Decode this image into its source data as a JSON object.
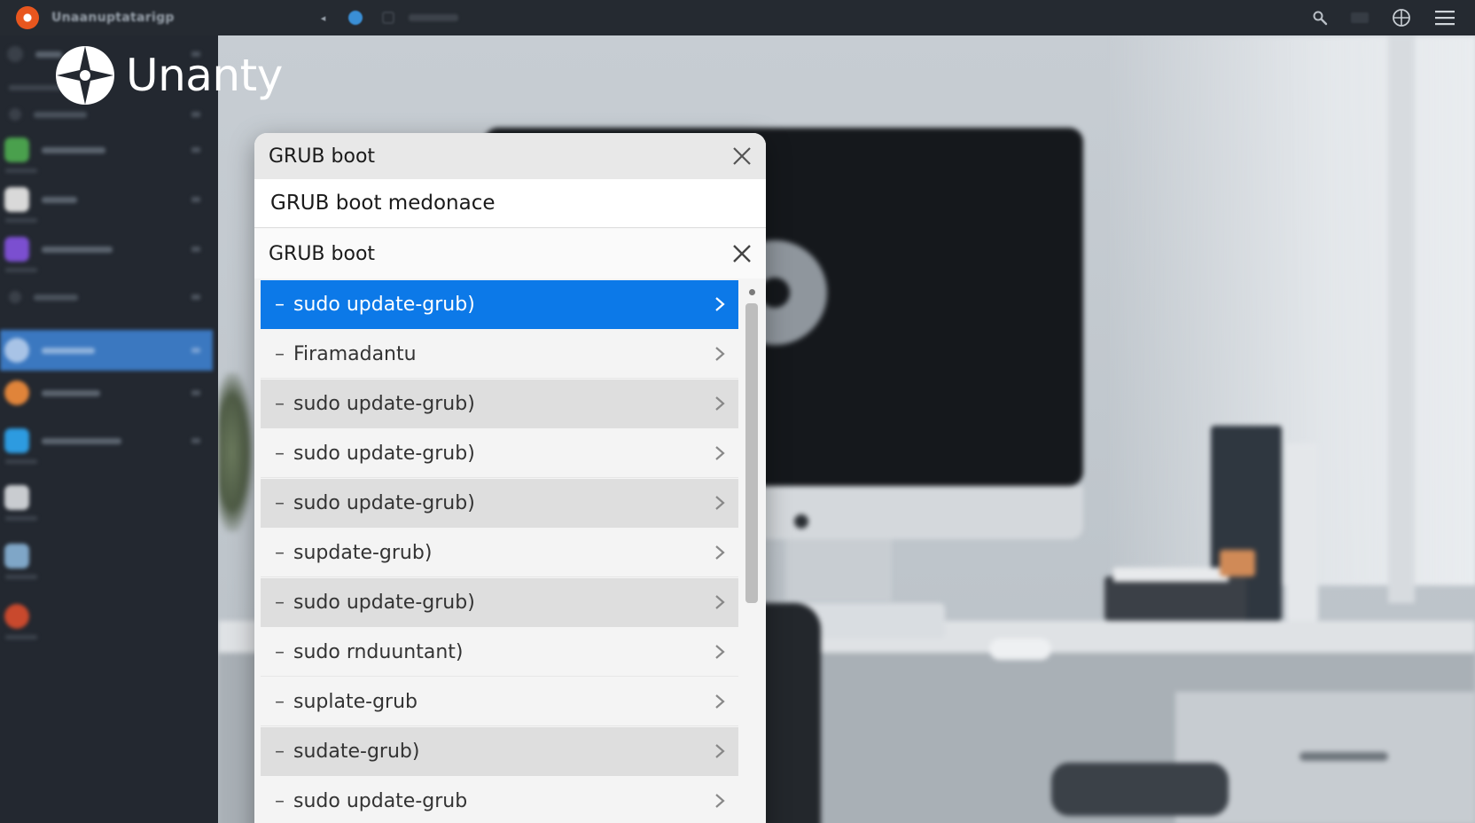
{
  "topbar": {
    "title": "Unaanuptatarigp",
    "arrow": "◂",
    "icons": [
      "app-logo-icon",
      "search-icon",
      "grid-icon",
      "globe-icon",
      "hamburger-menu-icon"
    ]
  },
  "brand": {
    "name": "Unanty"
  },
  "dialog": {
    "header_title": "GRUB boot",
    "subtitle": "GRUB boot medonace",
    "search_value": "GRUB boot",
    "items": [
      {
        "label": "sudo update-grub)",
        "state": "selected"
      },
      {
        "label": "Firamadantu",
        "state": "plain"
      },
      {
        "label": "sudo update-grub)",
        "state": "shade"
      },
      {
        "label": "sudo update-grub)",
        "state": "plain"
      },
      {
        "label": "sudo update-grub)",
        "state": "shade"
      },
      {
        "label": "supdate-grub)",
        "state": "plain"
      },
      {
        "label": "sudo update-grub)",
        "state": "shade"
      },
      {
        "label": "sudo rnduuntant)",
        "state": "plain"
      },
      {
        "label": "suplate-grub",
        "state": "plain"
      },
      {
        "label": "sudate-grub)",
        "state": "shade"
      },
      {
        "label": "sudo update-grub",
        "state": "plain"
      }
    ],
    "dash": "–"
  },
  "colors": {
    "selected": "#0c79e8",
    "topbar": "#252a31",
    "sidebar": "#232830",
    "sidebar_active": "#3b78c0"
  }
}
